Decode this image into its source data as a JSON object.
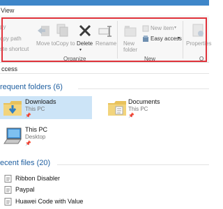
{
  "tab_view": "View",
  "ribbon": {
    "clipboard": {
      "copy_path": "opy path",
      "paste_shortcut": "ste shortcut",
      "first_item": "py"
    },
    "organize": {
      "move_to": "Move to",
      "copy_to": "Copy to",
      "delete": "Delete",
      "rename": "Rename",
      "group_label": "Organize"
    },
    "new": {
      "new_folder": "New folder",
      "new_item": "New item",
      "easy_access": "Easy access",
      "group_label": "New"
    },
    "open": {
      "properties": "Properties",
      "group_label": "O"
    }
  },
  "address": "ccess",
  "frequent": {
    "heading": "requent folders (6)",
    "items": [
      {
        "name": "Downloads",
        "location": "This PC",
        "selected": true
      },
      {
        "name": "Documents",
        "location": "This PC",
        "selected": false
      },
      {
        "name": "This PC",
        "location": "Desktop",
        "selected": false
      }
    ]
  },
  "recent": {
    "heading": "ecent files (20)",
    "items": [
      "Ribbon Disabler",
      "Paypal",
      "Huawei Code with Value"
    ]
  },
  "colors": {
    "accent_blue": "#3e86c9",
    "highlight_frame": "#e0323a",
    "selection": "#cce4f7",
    "heading_blue": "#1f5fa0"
  }
}
